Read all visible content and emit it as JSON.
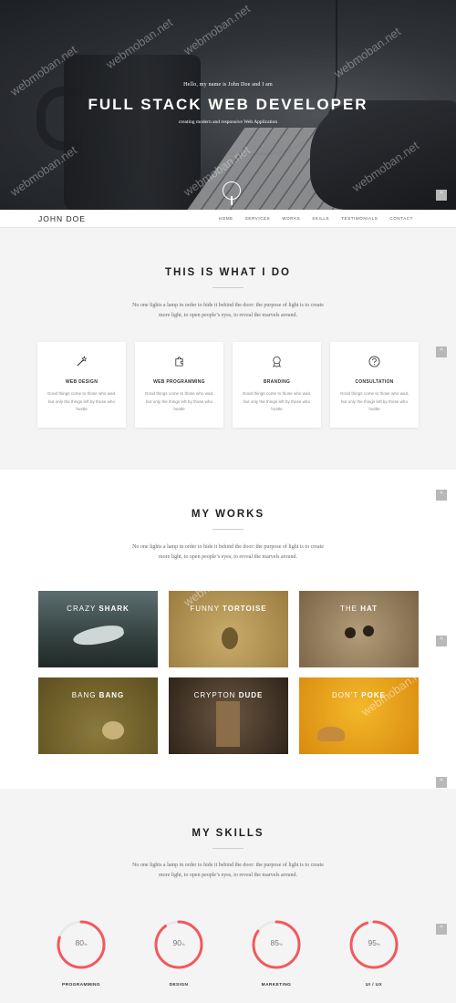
{
  "hero": {
    "greeting": "Hello, my name is John Doe and I am",
    "title": "FULL STACK WEB DEVELOPER",
    "subtitle": "creating modern and responsive Web Application"
  },
  "nav": {
    "brand": "JOHN DOE",
    "items": [
      "HOME",
      "SERVICES",
      "WORKS",
      "SKILLS",
      "TESTIMONIALS",
      "CONTACT"
    ]
  },
  "services": {
    "title": "THIS IS WHAT I DO",
    "text": "No one lights a lamp in order to hide it behind the door: the purpose of light is to create more light, to open people’s eyes, to reveal the marvels around.",
    "cards": [
      {
        "name": "WEB DESIGN",
        "icon": "magic-wand-icon",
        "desc": "Good things come to those who wait, but only the things left by those who hustle"
      },
      {
        "name": "WEB PROGRAMMING",
        "icon": "puzzle-icon",
        "desc": "Good things come to those who wait, but only the things left by those who hustle"
      },
      {
        "name": "BRANDING",
        "icon": "award-icon",
        "desc": "Good things come to those who wait, but only the things left by those who hustle"
      },
      {
        "name": "CONSULTATION",
        "icon": "question-icon",
        "desc": "Good things come to those who wait, but only the things left by those who hustle"
      }
    ]
  },
  "works": {
    "title": "MY WORKS",
    "text": "No one lights a lamp in order to hide it behind the door: the purpose of light is to create more light, to open people’s eyes, to reveal the marvels around.",
    "items": [
      {
        "light": "CRAZY",
        "bold": "SHARK",
        "color": "#2e3a3f"
      },
      {
        "light": "FUNNY",
        "bold": "TORTOISE",
        "color": "#a88a4c"
      },
      {
        "light": "THE",
        "bold": "HAT",
        "color": "#8a7453"
      },
      {
        "light": "BANG",
        "bold": "BANG",
        "color": "#6b5b2a"
      },
      {
        "light": "CRYPTON",
        "bold": "DUDE",
        "color": "#4a3c2c"
      },
      {
        "light": "DON'T",
        "bold": "POKE",
        "color": "#e09a14"
      }
    ]
  },
  "skills": {
    "title": "MY SKILLS",
    "text": "No one lights a lamp in order to hide it behind the door: the purpose of light is to create more light, to open people’s eyes, to reveal the marvels around.",
    "items": [
      {
        "label": "PROGRAMMING",
        "value": 80,
        "display": "80"
      },
      {
        "label": "DESIGN",
        "value": 90,
        "display": "90"
      },
      {
        "label": "MARKETING",
        "value": 85,
        "display": "85"
      },
      {
        "label": "UI / UX",
        "value": 95,
        "display": "95"
      }
    ],
    "unit": "%",
    "ring_color": "#f2595d"
  },
  "watermark": "webmoban.net",
  "totop_icon": "chevron-up-icon"
}
